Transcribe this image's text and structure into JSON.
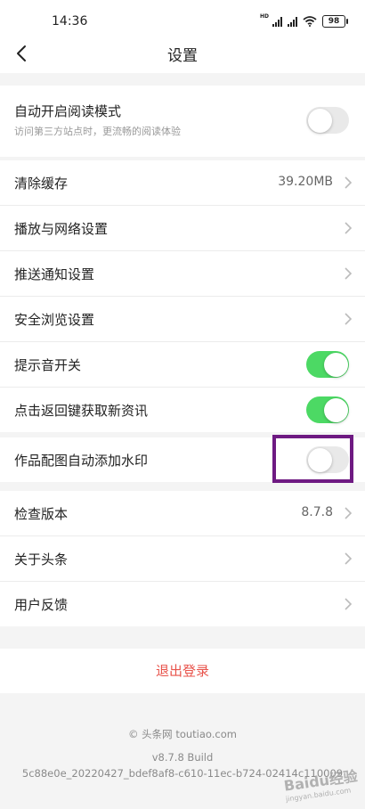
{
  "status_bar": {
    "time": "14:36",
    "battery": "98",
    "hd_label": "HD"
  },
  "header": {
    "title": "设置"
  },
  "reading_mode": {
    "label": "自动开启阅读模式",
    "subtitle": "访问第三方站点时，更流畅的阅读体验",
    "enabled": false
  },
  "general": [
    {
      "label": "清除缓存",
      "value": "39.20MB",
      "type": "chevron"
    },
    {
      "label": "播放与网络设置",
      "type": "chevron"
    },
    {
      "label": "推送通知设置",
      "type": "chevron"
    },
    {
      "label": "安全浏览设置",
      "type": "chevron"
    },
    {
      "label": "提示音开关",
      "type": "toggle",
      "enabled": true
    },
    {
      "label": "点击返回键获取新资讯",
      "type": "toggle",
      "enabled": true
    }
  ],
  "watermark_setting": {
    "label": "作品配图自动添加水印",
    "enabled": false
  },
  "about": [
    {
      "label": "检查版本",
      "value": "8.7.8"
    },
    {
      "label": "关于头条"
    },
    {
      "label": "用户反馈"
    }
  ],
  "logout": {
    "label": "退出登录"
  },
  "footer": {
    "copyright": "© 头条网 toutiao.com",
    "version": "v8.7.8 Build",
    "build": "5c88e0e_20220427_bdef8af8-c610-11ec-b724-02414c110009"
  },
  "overlay_watermark": {
    "brand": "Baidu经验",
    "url": "jingyan.baidu.com"
  },
  "colors": {
    "toggle_on": "#4cd964",
    "logout_text": "#e8534b",
    "highlight_box": "#6e1a82"
  }
}
